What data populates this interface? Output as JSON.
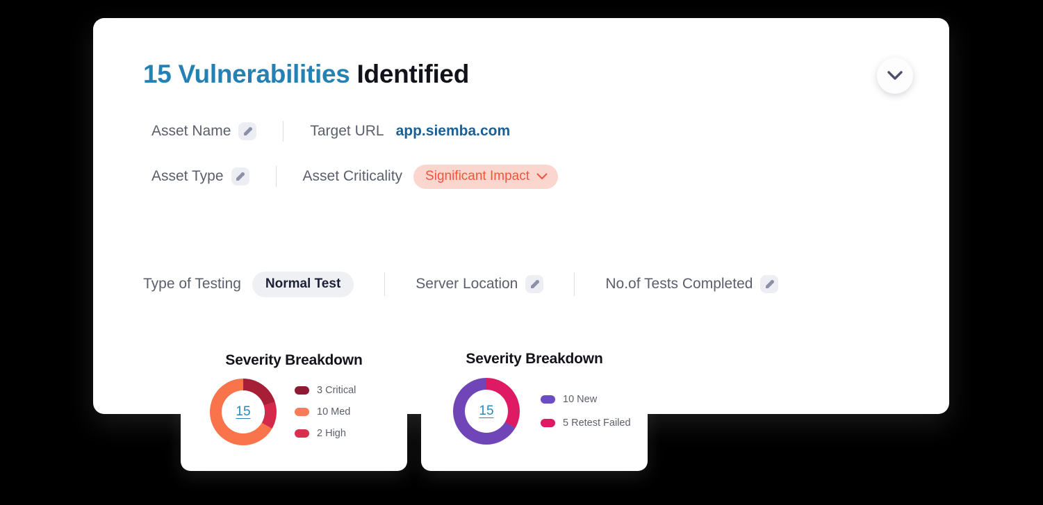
{
  "header": {
    "title_accent": "15 Vulnerabilities",
    "title_plain": " Identified",
    "collapse_icon": "chevron-down-icon"
  },
  "meta": {
    "asset_name_label": "Asset Name",
    "asset_name_edit_icon": "edit-pencil-icon",
    "target_url_label": "Target URL",
    "target_url_value": "app.siemba.com",
    "asset_type_label": "Asset Type",
    "asset_type_edit_icon": "edit-pencil-icon",
    "asset_criticality_label": "Asset Criticality",
    "asset_criticality_value": "Significant Impact",
    "asset_criticality_chevron": "chevron-down-icon"
  },
  "info": {
    "type_of_testing_label": "Type of Testing",
    "type_of_testing_value": "Normal Test",
    "server_location_label": "Server Location",
    "server_location_edit_icon": "edit-pencil-icon",
    "tests_completed_label": "No.of Tests Completed",
    "tests_completed_edit_icon": "edit-pencil-icon"
  },
  "colors": {
    "accent_blue": "#2581B4",
    "link_blue": "#1B6095",
    "center_blue": "#2589C0",
    "criticality_text": "#F4533C",
    "criticality_bg": "#FBD6CE",
    "pill_bg": "#EFF0F3",
    "pill_text": "#1D2138",
    "label_gray": "#5B5F6B"
  },
  "chart_data": [
    {
      "type": "pie",
      "title": "Severity Breakdown",
      "center_label": "15",
      "total": 15,
      "categories": [
        "Critical",
        "High",
        "Med"
      ],
      "values": [
        3,
        2,
        10
      ],
      "legend_labels": [
        "3 Critical",
        "10 Med",
        "2 High"
      ],
      "legend_order": [
        "Critical",
        "Med",
        "High"
      ],
      "legend_colors": [
        "#8E1B33",
        "#F97B57",
        "#D8304F"
      ],
      "slice_order": [
        "Critical",
        "High",
        "Med"
      ],
      "slice_colors": [
        "#A61F36",
        "#D3294B",
        "#F9734B"
      ],
      "legend_position": "right",
      "grid": false
    },
    {
      "type": "pie",
      "title": "Severity Breakdown",
      "center_label": "15",
      "total": 15,
      "categories": [
        "Retest Failed",
        "New"
      ],
      "values": [
        5,
        10
      ],
      "legend_labels": [
        "10 New",
        "5 Retest Failed"
      ],
      "legend_order": [
        "New",
        "Retest Failed"
      ],
      "legend_colors": [
        "#6B4DC4",
        "#DE1A65"
      ],
      "slice_order": [
        "Retest Failed",
        "New"
      ],
      "slice_colors": [
        "#DE1A65",
        "#6F45B8"
      ],
      "legend_position": "right",
      "grid": false
    }
  ]
}
